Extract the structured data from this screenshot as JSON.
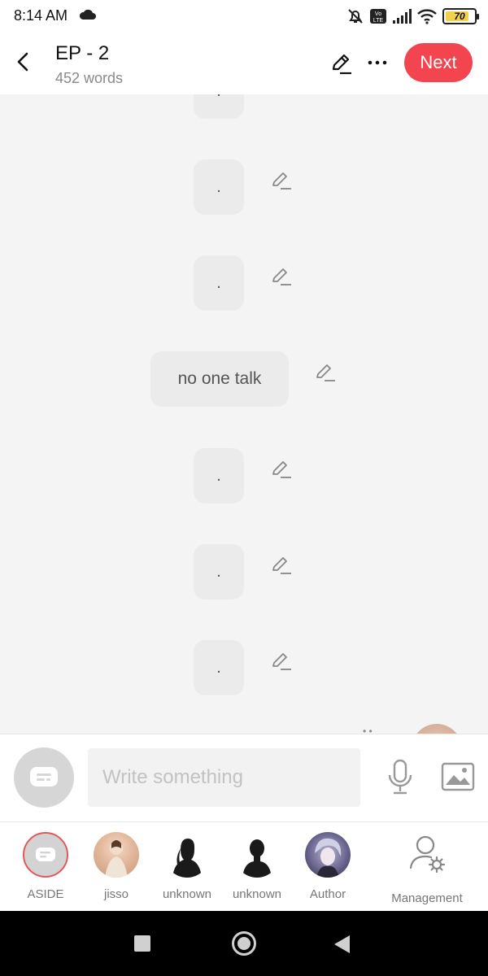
{
  "status_bar": {
    "time": "8:14 AM",
    "volte": "Vo LTE",
    "battery": "70"
  },
  "header": {
    "title": "EP - 2",
    "word_count": "452 words",
    "next_label": "Next"
  },
  "messages": [
    {
      "text": "."
    },
    {
      "text": "."
    },
    {
      "text": "."
    },
    {
      "text": "no one talk"
    },
    {
      "text": "."
    },
    {
      "text": "."
    },
    {
      "text": "."
    }
  ],
  "composer": {
    "placeholder": "Write something"
  },
  "characters": [
    {
      "label": "ASIDE"
    },
    {
      "label": "jisso"
    },
    {
      "label": "unknown"
    },
    {
      "label": "unknown"
    },
    {
      "label": "Author"
    },
    {
      "label": "Management"
    }
  ],
  "colors": {
    "accent": "#f24550",
    "bubble": "#ebebeb",
    "background": "#f4f4f4"
  }
}
